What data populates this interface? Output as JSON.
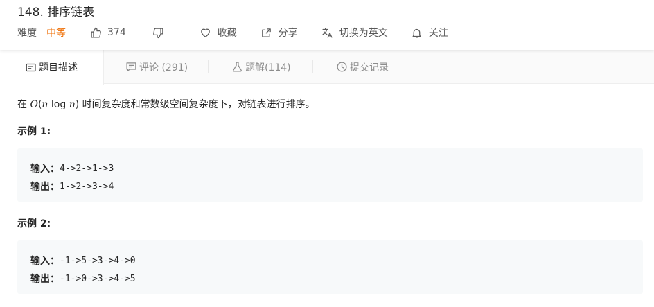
{
  "problem": {
    "title": "148. 排序链表",
    "difficulty_label": "难度",
    "difficulty_value": "中等",
    "likes": "374",
    "favorite_label": "收藏",
    "share_label": "分享",
    "switch_lang_label": "切换为英文",
    "follow_label": "关注"
  },
  "tabs": {
    "description": "题目描述",
    "comments": "评论 (291)",
    "solutions": "题解(114)",
    "submissions": "提交记录"
  },
  "statement": {
    "prefix": "在 ",
    "complexity_O": "O",
    "complexity_open": "(",
    "complexity_n1": "n",
    "complexity_log": " log ",
    "complexity_n2": "n",
    "complexity_close": ")",
    "suffix": " 时间复杂度和常数级空间复杂度下，对链表进行排序。"
  },
  "examples": [
    {
      "title": "示例 1:",
      "input_label": "输入：",
      "input_value": "4->2->1->3",
      "output_label": "输出：",
      "output_value": "1->2->3->4"
    },
    {
      "title": "示例 2:",
      "input_label": "输入：",
      "input_value": "-1->5->3->4->0",
      "output_label": "输出：",
      "output_value": "-1->0->3->4->5"
    }
  ],
  "colors": {
    "difficulty_medium": "#ef6c00",
    "code_bg": "#f7f9fa",
    "tab_bar_bg": "#fafafa"
  }
}
